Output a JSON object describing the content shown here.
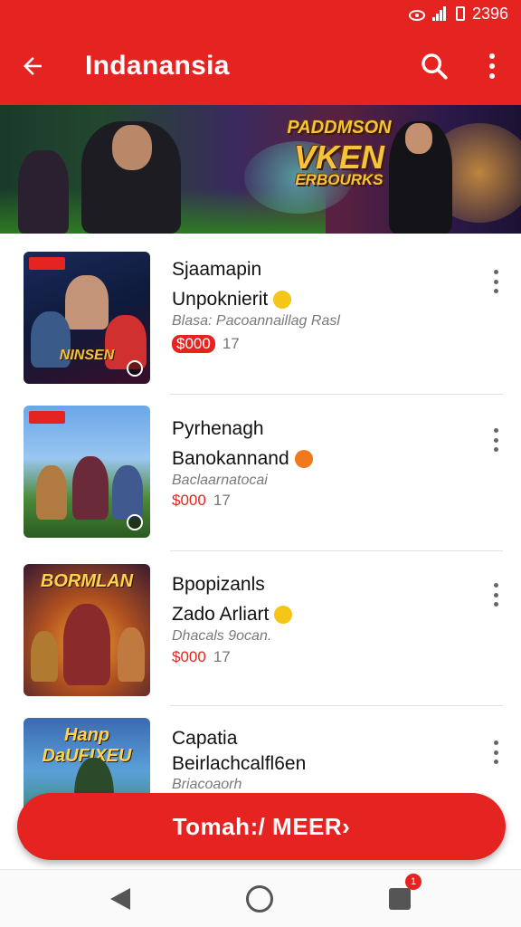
{
  "status_bar": {
    "time": "2396"
  },
  "app_bar": {
    "title": "Indanansia",
    "back_icon": "arrow-left-icon",
    "search_icon": "search-icon",
    "more_icon": "more-vertical-icon"
  },
  "banner": {
    "line1": "PADDMSON",
    "line2": "VKEN",
    "line3": "ERBOURKS"
  },
  "items": [
    {
      "title": "Sjaamapin",
      "subtitle": "Unpoknierit",
      "desc": "Blasa: Pacoannaillag Rasl",
      "price": "$000",
      "count": "17",
      "price_style": "pill",
      "emoji_color": "#f5c518",
      "thumb_label": "NINSEN"
    },
    {
      "title": "Pyrhenagh",
      "subtitle": "Banokannand",
      "desc": "Baclaarnatocai",
      "price": "$000",
      "count": "17",
      "price_style": "plain",
      "emoji_color": "#f07a1a",
      "thumb_label": ""
    },
    {
      "title": "Bpopizanls",
      "subtitle": "Zado Arliart",
      "desc": "Dhacals 9ocan.",
      "price": "$000",
      "count": "17",
      "price_style": "plain",
      "emoji_color": "#f5c518",
      "thumb_label": "BORMLAN"
    },
    {
      "title": "Capatia",
      "subtitle": "Beirlachcalfl6en",
      "desc": "Briacoaorh",
      "price": "",
      "count": "",
      "price_style": "plain",
      "emoji_color": "",
      "thumb_label": "Hanp DaUFIXEU"
    }
  ],
  "cta": {
    "label": "Tomah:/ MEER›"
  },
  "nav": {
    "recent_badge": "1"
  },
  "colors": {
    "accent": "#e52421"
  }
}
